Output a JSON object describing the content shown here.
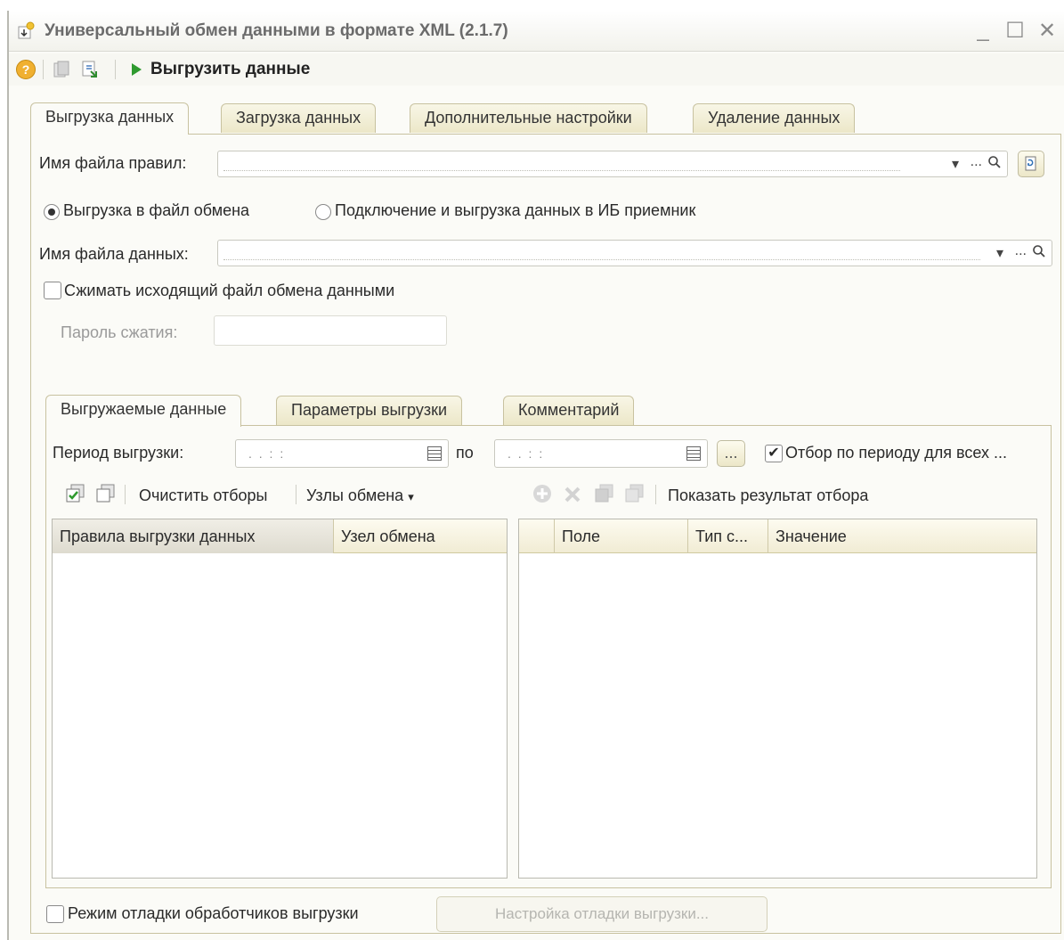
{
  "window": {
    "title": "Универсальный обмен данными в формате XML (2.1.7)",
    "controls": [
      "_",
      "☐",
      "✕"
    ]
  },
  "toolbar": {
    "help": "?",
    "run_label": "Выгрузить данные"
  },
  "tabs": [
    {
      "label": "Выгрузка данных",
      "active": true
    },
    {
      "label": "Загрузка данных",
      "active": false
    },
    {
      "label": "Дополнительные настройки",
      "active": false
    },
    {
      "label": "Удаление данных",
      "active": false
    }
  ],
  "export": {
    "rules_file_label": "Имя файла правил:",
    "rules_file_value": "",
    "mode_file_label": "Выгрузка в файл обмена",
    "mode_ib_label": "Подключение и выгрузка данных в ИБ приемник",
    "mode_selected": "file",
    "data_file_label": "Имя файла данных:",
    "data_file_value": "",
    "compress_label": "Сжимать исходящий файл обмена данными",
    "compress_checked": false,
    "password_label": "Пароль сжатия:",
    "password_value": ""
  },
  "subtabs": [
    {
      "label": "Выгружаемые данные",
      "active": true
    },
    {
      "label": "Параметры выгрузки",
      "active": false
    },
    {
      "label": "Комментарий",
      "active": false
    }
  ],
  "period": {
    "label": "Период выгрузки:",
    "from_value": ". .     : :",
    "to_label": "по",
    "to_value": ". .     : :",
    "more_button": "...",
    "filter_all_label": "Отбор по периоду для всех ...",
    "filter_all_checked": true
  },
  "left_toolbar": {
    "clear_filters": "Очистить отборы",
    "exchange_nodes": "Узлы обмена"
  },
  "right_toolbar": {
    "show_result": "Показать результат отбора"
  },
  "rules_grid": {
    "columns": [
      "Правила выгрузки данных",
      "Узел обмена"
    ]
  },
  "filter_grid": {
    "columns": [
      "Поле",
      "Тип с...",
      "Значение"
    ]
  },
  "footer": {
    "debug_label": "Режим отладки обработчиков выгрузки",
    "debug_checked": false,
    "debug_settings_button": "Настройка отладки выгрузки..."
  },
  "colors": {
    "tab_fill": "#ece7c8",
    "run_icon": "#2f9a2f",
    "help_icon": "#f0b030"
  }
}
